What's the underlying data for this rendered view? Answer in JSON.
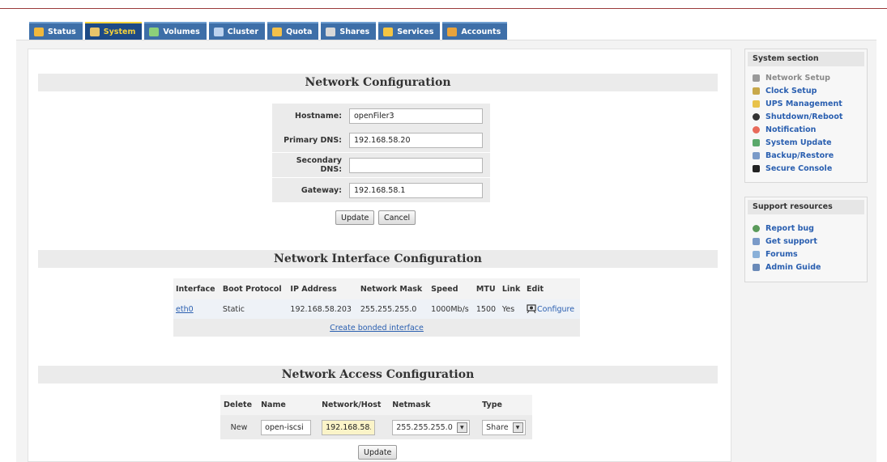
{
  "tabs": [
    {
      "label": "Status",
      "icon": "status-icon",
      "color": "#f0b83c"
    },
    {
      "label": "System",
      "icon": "system-icon",
      "color": "#e8c46a",
      "active": true
    },
    {
      "label": "Volumes",
      "icon": "volumes-icon",
      "color": "#8ccf7a"
    },
    {
      "label": "Cluster",
      "icon": "cluster-icon",
      "color": "#bcd2ee"
    },
    {
      "label": "Quota",
      "icon": "quota-icon",
      "color": "#f2c04a"
    },
    {
      "label": "Shares",
      "icon": "shares-icon",
      "color": "#d8d8d8"
    },
    {
      "label": "Services",
      "icon": "services-icon",
      "color": "#f5c542"
    },
    {
      "label": "Accounts",
      "icon": "accounts-icon",
      "color": "#e8a33c"
    }
  ],
  "network_config": {
    "title": "Network Configuration",
    "hostname_label": "Hostname:",
    "hostname_value": "openFiler3",
    "primary_dns_label": "Primary DNS:",
    "primary_dns_value": "192.168.58.20",
    "secondary_dns_label": "Secondary DNS:",
    "secondary_dns_value": "",
    "gateway_label": "Gateway:",
    "gateway_value": "192.168.58.1",
    "update_label": "Update",
    "cancel_label": "Cancel"
  },
  "interface_config": {
    "title": "Network Interface Configuration",
    "columns": [
      "Interface",
      "Boot Protocol",
      "IP Address",
      "Network Mask",
      "Speed",
      "MTU",
      "Link",
      "Edit"
    ],
    "row": {
      "interface": "eth0",
      "boot_protocol": "Static",
      "ip_address": "192.168.58.203",
      "network_mask": "255.255.255.0",
      "speed": "1000Mb/s",
      "mtu": "1500",
      "link": "Yes",
      "edit": "Configure"
    },
    "bonded_link": "Create bonded interface"
  },
  "access_config": {
    "title": "Network Access Configuration",
    "columns": [
      "Delete",
      "Name",
      "Network/Host",
      "Netmask",
      "Type"
    ],
    "row": {
      "delete": "New",
      "name": "open-iscsi",
      "network_host": "192.168.58.",
      "netmask": "255.255.255.0",
      "type": "Share"
    },
    "update_label": "Update"
  },
  "sidebar": {
    "system_title": "System section",
    "system_items": [
      {
        "label": "Network Setup",
        "icon": "network-setup-icon",
        "color": "#9a9a9a",
        "current": true
      },
      {
        "label": "Clock Setup",
        "icon": "clock-icon",
        "color": "#c8a84a"
      },
      {
        "label": "UPS Management",
        "icon": "ups-icon",
        "color": "#e8c24a"
      },
      {
        "label": "Shutdown/Reboot",
        "icon": "power-icon",
        "color": "#333333"
      },
      {
        "label": "Notification",
        "icon": "notification-icon",
        "color": "#e86a5a"
      },
      {
        "label": "System Update",
        "icon": "update-icon",
        "color": "#5aa86a"
      },
      {
        "label": "Backup/Restore",
        "icon": "backup-icon",
        "color": "#7a9ac8"
      },
      {
        "label": "Secure Console",
        "icon": "console-icon",
        "color": "#222222"
      }
    ],
    "support_title": "Support resources",
    "support_items": [
      {
        "label": "Report bug",
        "icon": "bug-icon",
        "color": "#5a9a5a"
      },
      {
        "label": "Get support",
        "icon": "support-icon",
        "color": "#7a9ac8"
      },
      {
        "label": "Forums",
        "icon": "forums-icon",
        "color": "#8ab0d8"
      },
      {
        "label": "Admin Guide",
        "icon": "guide-icon",
        "color": "#6a8ab8"
      }
    ]
  }
}
